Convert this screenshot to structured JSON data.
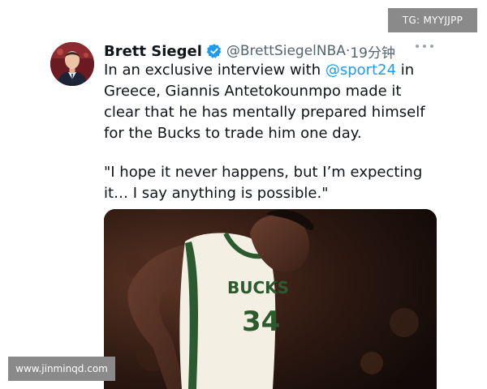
{
  "tweet": {
    "author_name": "Brett Siegel",
    "handle": "@BrettSiegelNBA",
    "separator": "·",
    "time": "19分钟",
    "text_part1": "In an exclusive interview with ",
    "mention": "@sport24",
    "text_part2": " in Greece, Giannis Antetokounmpo made it clear that he has mentally prepared himself for the Bucks to trade him one day.",
    "quote": "\"I hope it never happens, but I’m expecting it… I say anything is possible.\""
  },
  "media": {
    "jersey_text": "BUCKS",
    "jersey_number": "34"
  },
  "overlays": {
    "tg_badge": "TG: MYYJJPP",
    "site_watermark": "www.jinminqd.com"
  },
  "colors": {
    "link": "#1d9bf0",
    "verified": "#1d9bf0",
    "secondary_text": "#536471",
    "badge_bg": "#8a8a8a"
  },
  "icons": {
    "verified": "verified-badge-icon",
    "more": "more-options-icon"
  }
}
